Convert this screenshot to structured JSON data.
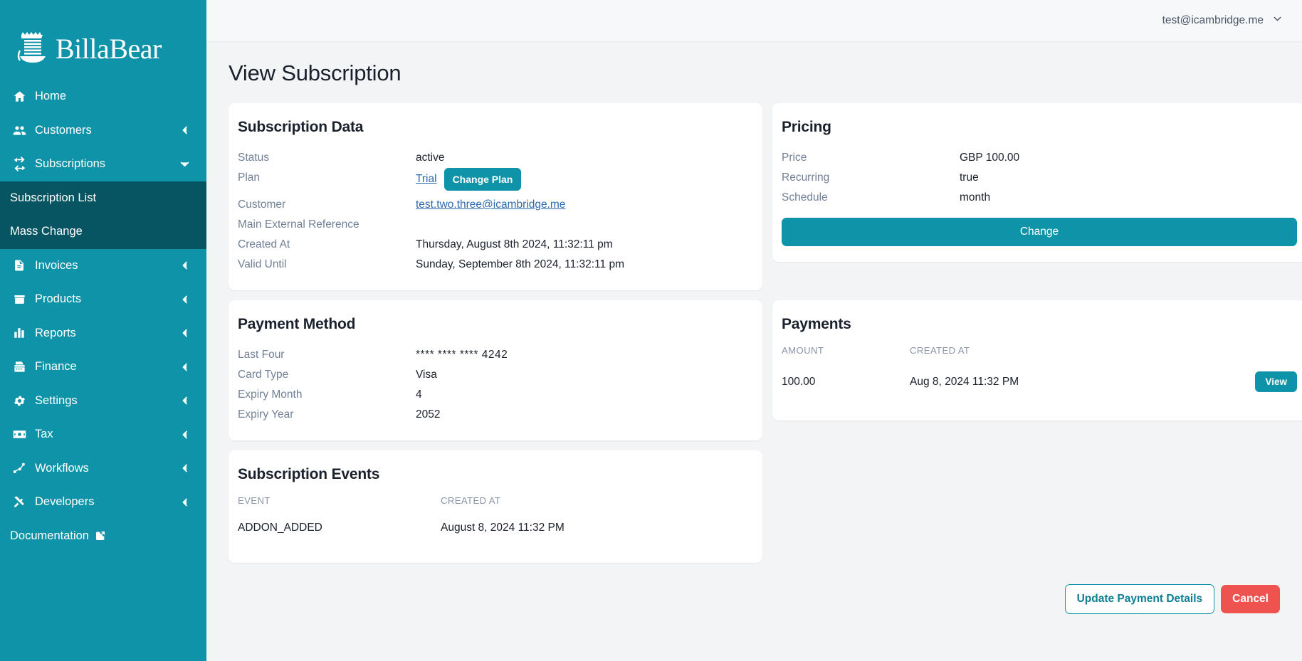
{
  "brand": {
    "name": "BillaBear",
    "logo_icon": "billabear-logo-icon"
  },
  "sidebar": {
    "items": [
      {
        "label": "Home",
        "icon": "home-icon",
        "caret": "none"
      },
      {
        "label": "Customers",
        "icon": "customers-icon",
        "caret": "chevron-left-icon"
      },
      {
        "label": "Subscriptions",
        "icon": "subscriptions-icon",
        "caret": "chevron-down-icon"
      }
    ],
    "subscription_children": [
      {
        "label": "Subscription List",
        "active": true
      },
      {
        "label": "Mass Change",
        "active": false
      }
    ],
    "items_after": [
      {
        "label": "Invoices",
        "icon": "invoice-icon",
        "caret": "chevron-left-icon"
      },
      {
        "label": "Products",
        "icon": "products-icon",
        "caret": "chevron-left-icon"
      },
      {
        "label": "Reports",
        "icon": "reports-icon",
        "caret": "chevron-left-icon"
      },
      {
        "label": "Finance",
        "icon": "finance-icon",
        "caret": "chevron-left-icon"
      },
      {
        "label": "Settings",
        "icon": "gear-icon",
        "caret": "chevron-left-icon"
      },
      {
        "label": "Tax",
        "icon": "tax-icon",
        "caret": "chevron-left-icon"
      },
      {
        "label": "Workflows",
        "icon": "workflows-icon",
        "caret": "chevron-left-icon"
      },
      {
        "label": "Developers",
        "icon": "developers-icon",
        "caret": "chevron-left-icon"
      }
    ],
    "documentation": {
      "label": "Documentation",
      "icon": "external-link-icon"
    }
  },
  "topbar": {
    "account_email": "test@icambridge.me",
    "account_caret_icon": "chevron-down-icon"
  },
  "page": {
    "title": "View Subscription"
  },
  "subscription_data": {
    "title": "Subscription Data",
    "rows": [
      {
        "key": "Status",
        "value": "active"
      },
      {
        "key": "Plan",
        "value": "Trial"
      },
      {
        "key": "Customer",
        "value": "test.two.three@icambridge.me"
      },
      {
        "key": "Main External Reference",
        "value": ""
      },
      {
        "key": "Created At",
        "value": "Thursday, August 8th 2024, 11:32:11 pm"
      },
      {
        "key": "Valid Until",
        "value": "Sunday, September 8th 2024, 11:32:11 pm"
      }
    ],
    "change_plan_label": "Change Plan"
  },
  "pricing": {
    "title": "Pricing",
    "rows": [
      {
        "key": "Price",
        "value": "GBP 100.00"
      },
      {
        "key": "Recurring",
        "value": "true"
      },
      {
        "key": "Schedule",
        "value": "month"
      }
    ],
    "change_label": "Change"
  },
  "payment_method": {
    "title": "Payment Method",
    "rows": [
      {
        "key": "Last Four",
        "value": "**** **** **** 4242"
      },
      {
        "key": "Card Type",
        "value": "Visa"
      },
      {
        "key": "Expiry Month",
        "value": "4"
      },
      {
        "key": "Expiry Year",
        "value": "2052"
      }
    ]
  },
  "payments": {
    "title": "Payments",
    "columns": [
      "AMOUNT",
      "CREATED AT",
      ""
    ],
    "rows": [
      {
        "amount": "100.00",
        "created_at": "Aug 8, 2024 11:32 PM",
        "action_label": "View"
      }
    ]
  },
  "subscription_events": {
    "title": "Subscription Events",
    "columns": [
      "EVENT",
      "CREATED AT"
    ],
    "rows": [
      {
        "event": "ADDON_ADDED",
        "created_at": "August 8, 2024 11:32 PM"
      }
    ]
  },
  "footer_actions": {
    "update_payment_label": "Update Payment Details",
    "cancel_label": "Cancel"
  },
  "colors": {
    "brand_teal": "#0e93a8",
    "active_nav": "#075562",
    "danger": "#ef5350",
    "link": "#2b6cb0",
    "page_bg": "#f3f4f6"
  }
}
